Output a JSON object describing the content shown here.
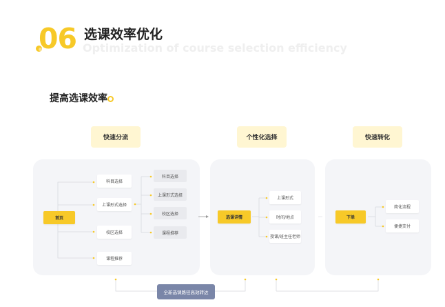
{
  "header": {
    "number": "06",
    "title_cn": "选课效率优化",
    "title_en": "Optimization of course selection efficiency"
  },
  "section_title": "提高选课效率",
  "stages": [
    {
      "label": "快速分流"
    },
    {
      "label": "个性化选择"
    },
    {
      "label": "快速转化"
    }
  ],
  "panel1": {
    "root": "首页",
    "level1": [
      "科目选择",
      "上课形式选择",
      "校区选择",
      "课程推荐"
    ],
    "level2": [
      "科目选择",
      "上课形式选择",
      "校区选择",
      "课程推荐"
    ]
  },
  "panel2": {
    "root": "选课详情",
    "items": [
      "上课形式",
      "时间/地点",
      "授课/班主任老师"
    ]
  },
  "panel3": {
    "root": "下单",
    "items": [
      "简化流程",
      "便捷支付"
    ]
  },
  "cta": "全新选课路径高效转达",
  "colors": {
    "accent": "#F7C928",
    "stage_bg": "#FFF6D2",
    "panel_bg": "#F4F5F8",
    "cta_bg": "#7A86A8"
  }
}
